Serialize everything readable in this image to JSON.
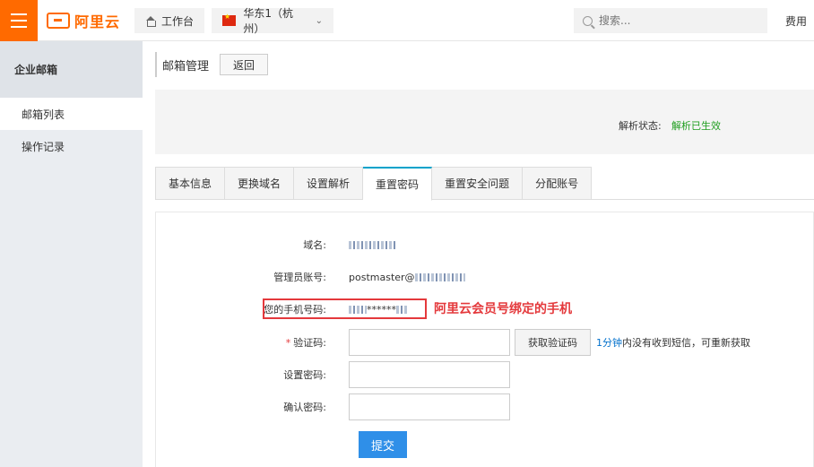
{
  "topbar": {
    "logo_text": "阿里云",
    "workbench_label": "工作台",
    "region_label": "华东1（杭州）",
    "search_placeholder": "搜索...",
    "fee_label": "费用"
  },
  "sidebar": {
    "title": "企业邮箱",
    "items": [
      {
        "label": "邮箱列表",
        "active": true
      },
      {
        "label": "操作记录",
        "active": false
      }
    ]
  },
  "main": {
    "title": "邮箱管理",
    "back_label": "返回",
    "status_label": "解析状态:",
    "status_value": "解析已生效",
    "tabs": [
      {
        "label": "基本信息",
        "active": false
      },
      {
        "label": "更换域名",
        "active": false
      },
      {
        "label": "设置解析",
        "active": false
      },
      {
        "label": "重置密码",
        "active": true
      },
      {
        "label": "重置安全问题",
        "active": false
      },
      {
        "label": "分配账号",
        "active": false
      }
    ],
    "form": {
      "domain_label": "域名:",
      "admin_label": "管理员账号:",
      "admin_value_prefix": "postmaster@",
      "phone_label": "您的手机号码:",
      "phone_masked": "******",
      "annotation": "阿里云会员号绑定的手机",
      "code_required_mark": "*",
      "code_label": "验证码:",
      "get_code_label": "获取验证码",
      "hint_time": "1分钟",
      "hint_text": "内没有收到短信，可重新获取",
      "password_label": "设置密码:",
      "confirm_label": "确认密码:",
      "submit_label": "提交"
    }
  },
  "colors": {
    "brand": "#ff6a00",
    "tab_accent": "#00a2ca",
    "success": "#1f9e1f",
    "highlight": "#e4393c",
    "primary_button": "#2f8fe8",
    "link": "#0070cc"
  }
}
